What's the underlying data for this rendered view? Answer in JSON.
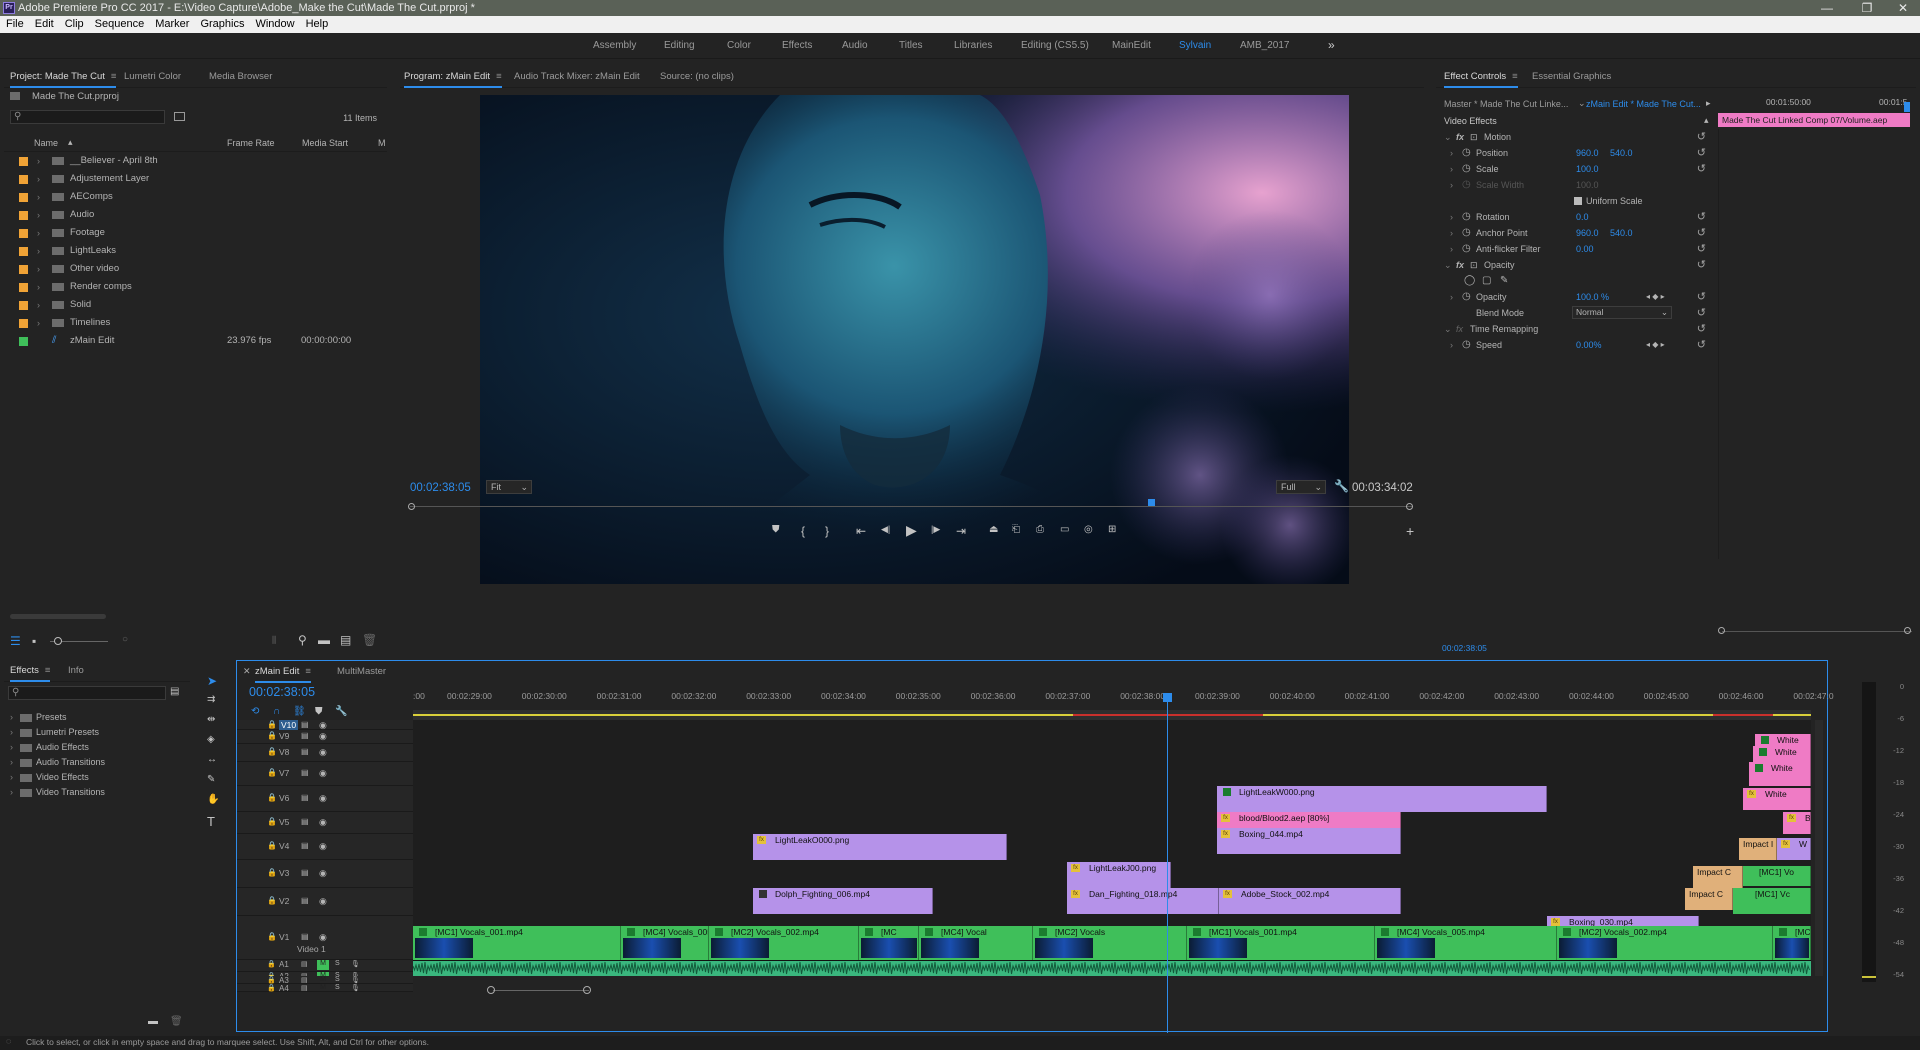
{
  "window": {
    "title": "Adobe Premiere Pro CC 2017 - E:\\Video Capture\\Adobe_Make the Cut\\Made The Cut.prproj *",
    "app_icon": "Pr",
    "controls": [
      "—",
      "❐",
      "✕"
    ]
  },
  "menu": [
    "File",
    "Edit",
    "Clip",
    "Sequence",
    "Marker",
    "Graphics",
    "Window",
    "Help"
  ],
  "workspaces": {
    "items": [
      "Assembly",
      "Editing",
      "Color",
      "Effects",
      "Audio",
      "Titles",
      "Libraries",
      "Editing (CS5.5)",
      "MainEdit",
      "Sylvain",
      "AMB_2017"
    ],
    "active": "Sylvain",
    "more": "»"
  },
  "project": {
    "tabs": [
      "Project: Made The Cut",
      "Lumetri Color",
      "Media Browser"
    ],
    "file": "Made The Cut.prproj",
    "search_placeholder": "",
    "item_count": "11 Items",
    "columns": {
      "name": "Name",
      "frame_rate": "Frame Rate",
      "media_start": "Media Start",
      "more": "M"
    },
    "items": [
      {
        "name": "__Believer - April 8th",
        "type": "bin",
        "color": "#f0a336",
        "fps": "",
        "start": ""
      },
      {
        "name": "Adjustement Layer",
        "type": "bin",
        "color": "#f0a336",
        "fps": "",
        "start": ""
      },
      {
        "name": "AEComps",
        "type": "bin",
        "color": "#f0a336",
        "fps": "",
        "start": ""
      },
      {
        "name": "Audio",
        "type": "bin",
        "color": "#f0a336",
        "fps": "",
        "start": ""
      },
      {
        "name": "Footage",
        "type": "bin",
        "color": "#f0a336",
        "fps": "",
        "start": ""
      },
      {
        "name": "LightLeaks",
        "type": "bin",
        "color": "#f0a336",
        "fps": "",
        "start": ""
      },
      {
        "name": "Other video",
        "type": "bin",
        "color": "#f0a336",
        "fps": "",
        "start": ""
      },
      {
        "name": "Render comps",
        "type": "bin",
        "color": "#f0a336",
        "fps": "",
        "start": ""
      },
      {
        "name": "Solid",
        "type": "bin",
        "color": "#f0a336",
        "fps": "",
        "start": ""
      },
      {
        "name": "Timelines",
        "type": "bin",
        "color": "#f0a336",
        "fps": "",
        "start": ""
      },
      {
        "name": "zMain Edit",
        "type": "sequence",
        "color": "#3fbf5a",
        "fps": "23.976 fps",
        "start": "00:00:00:00"
      }
    ]
  },
  "program": {
    "tabs": [
      "Program: zMain Edit",
      "Audio Track Mixer: zMain Edit",
      "Source: (no clips)"
    ],
    "timecode": "00:02:38:05",
    "fit": "Fit",
    "quality": "Full",
    "duration": "00:03:34:02",
    "playhead_fraction": 0.74
  },
  "effect_controls": {
    "tabs": [
      "Effect Controls",
      "Essential Graphics"
    ],
    "master": "Master * Made The Cut Linke...",
    "sequence": "zMain Edit * Made The Cut...",
    "ruler_time": "00:01:50:00",
    "ruler_time2": "00:01:5",
    "clip_bar": "Made The Cut Linked Comp 07/Volume.aep",
    "section": "Video Effects",
    "rows": [
      {
        "kind": "group",
        "label": "Motion",
        "fx": true
      },
      {
        "kind": "prop",
        "label": "Position",
        "v1": "960.0",
        "v2": "540.0"
      },
      {
        "kind": "prop",
        "label": "Scale",
        "v1": "100.0",
        "v2": ""
      },
      {
        "kind": "prop",
        "label": "Scale Width",
        "v1": "100.0",
        "v2": "",
        "disabled": true
      },
      {
        "kind": "check",
        "label": "Uniform Scale"
      },
      {
        "kind": "prop",
        "label": "Rotation",
        "v1": "0.0",
        "v2": ""
      },
      {
        "kind": "prop",
        "label": "Anchor Point",
        "v1": "960.0",
        "v2": "540.0"
      },
      {
        "kind": "prop",
        "label": "Anti-flicker Filter",
        "v1": "0.00",
        "v2": ""
      },
      {
        "kind": "group",
        "label": "Opacity",
        "fx": true
      },
      {
        "kind": "masks",
        "label": ""
      },
      {
        "kind": "prop",
        "label": "Opacity",
        "v1": "100.0 %",
        "v2": ""
      },
      {
        "kind": "select",
        "label": "Blend Mode",
        "v1": "Normal"
      },
      {
        "kind": "group",
        "label": "Time Remapping",
        "fx": false
      },
      {
        "kind": "prop",
        "label": "Speed",
        "v1": "0.00%",
        "v2": ""
      }
    ],
    "footer_timecode": "00:02:38:05"
  },
  "effects": {
    "tabs": [
      "Effects",
      "Info"
    ],
    "items": [
      "Presets",
      "Lumetri Presets",
      "Audio Effects",
      "Audio Transitions",
      "Video Effects",
      "Video Transitions"
    ]
  },
  "timeline": {
    "tabs": [
      "zMain Edit",
      "MultiMaster"
    ],
    "timecode": "00:02:38:05",
    "ruler": [
      "00:02:29:00",
      "00:02:30:00",
      "00:02:31:00",
      "00:02:32:00",
      "00:02:33:00",
      "00:02:34:00",
      "00:02:35:00",
      "00:02:36:00",
      "00:02:37:00",
      "00:02:38:00",
      "00:02:39:00",
      "00:02:40:00",
      "00:02:41:00",
      "00:02:42:00",
      "00:02:43:00",
      "00:02:44:00",
      "00:02:45:00",
      "00:02:46:00",
      "00:02:47:0"
    ],
    "ruler_start_label": ":00",
    "video_tracks": [
      "V10",
      "V9",
      "V8",
      "V7",
      "V6",
      "V5",
      "V4",
      "V3",
      "V2",
      "V1"
    ],
    "v1_name": "Video 1",
    "audio_tracks": [
      "A1",
      "A2",
      "A3",
      "A4"
    ],
    "clips": {
      "lightleak_w000": "LightLeakW000.png",
      "blood": "blood/Blood2.aep [80%]",
      "boxing_044": "Boxing_044.mp4",
      "lightleak_o000": "LightLeakO000.png",
      "lightleak_j00": "LightLeakJ00.png",
      "dolph": "Dolph_Fighting_006.mp4",
      "dan": "Dan_Fighting_018.mp4",
      "adobe_stock": "Adobe_Stock_002.mp4",
      "boxing_030": "Boxing_030.mp4",
      "white1": "White",
      "white2": "White",
      "white3": "White",
      "white4": "White",
      "bl": "Bl",
      "impact1": "Impact I",
      "impact2": "Impact C",
      "impact3": "Impact C",
      "mc1v": "[MC1] Vo",
      "mc1v2": "[MC1] Vc",
      "w": "W",
      "v1_clips": [
        "[MC1] Vocals_001.mp4",
        "[MC4] Vocals_005.mp4",
        "[MC2] Vocals_002.mp4",
        "[MC",
        "[MC4] Vocal",
        "[MC2] Vocals",
        "[MC1] Vocals_001.mp4",
        "[MC4] Vocals_005.mp4",
        "[MC2] Vocals_002.mp4",
        "[MC1] Vocals_001.mp"
      ]
    },
    "meter_scale": [
      "0",
      "-6",
      "-12",
      "-18",
      "-24",
      "-30",
      "-36",
      "-42",
      "-48",
      "-54"
    ]
  },
  "status": "Click to select, or click in empty space and drag to marquee select. Use Shift, Alt, and Ctrl for other options.",
  "colors": {
    "accent": "#2d8ceb",
    "purple_clip": "#b592e9",
    "pink_clip": "#ef7bc5",
    "green_clip": "#3fbf5a",
    "bin": "#f0a336"
  }
}
